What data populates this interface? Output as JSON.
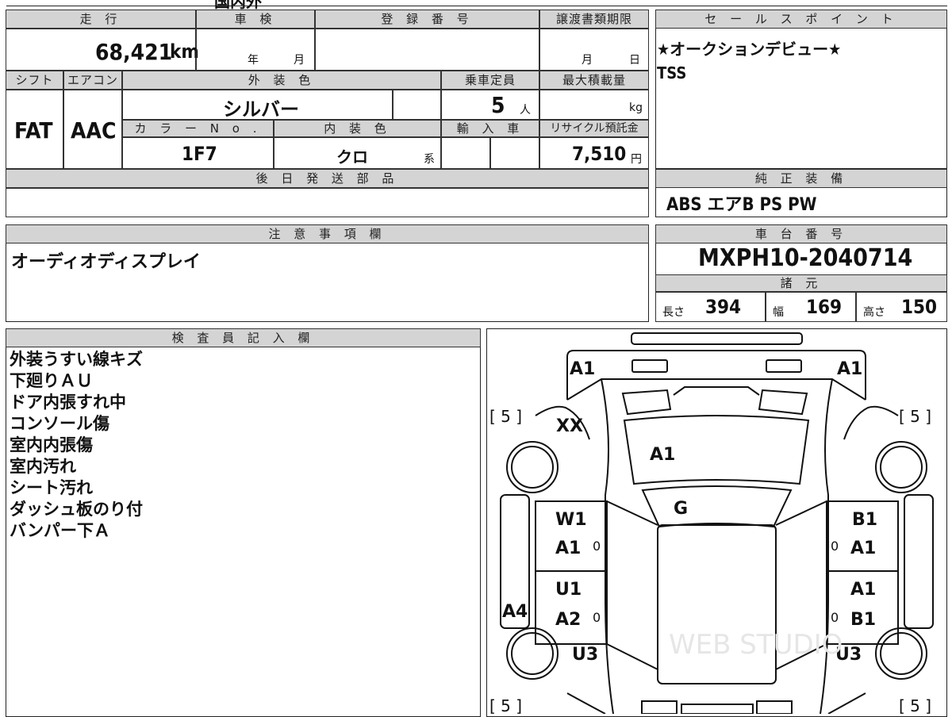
{
  "top_fragment": "国内外",
  "odometer": {
    "header": "走 行",
    "value": "68,421",
    "unit": "km"
  },
  "inspection": {
    "header": "車 検",
    "year_label": "年",
    "month_label": "月"
  },
  "registration": {
    "header": "登 録 番 号",
    "value": ""
  },
  "transfer_deadline": {
    "header": "譲渡書類期限",
    "month_label": "月",
    "day_label": "日"
  },
  "sales_point": {
    "header": "セ ー ル ス ポ イ ン ト",
    "lines": [
      "★オークションデビュー★",
      "TSS"
    ]
  },
  "shift": {
    "header": "シフト",
    "value": "FAT"
  },
  "aircon": {
    "header": "エアコン",
    "value": "AAC"
  },
  "exterior_color": {
    "header": "外 装 色",
    "value": "シルバー"
  },
  "capacity": {
    "header": "乗車定員",
    "value": "5",
    "unit": "人"
  },
  "max_load": {
    "header": "最大積載量",
    "unit": "kg"
  },
  "color_no": {
    "header": "カ ラ ー N o .",
    "value": "1F7"
  },
  "interior_color": {
    "header": "内 装 色",
    "value": "クロ",
    "suffix": "系"
  },
  "import": {
    "header": "輸 入 車",
    "value": ""
  },
  "recycle": {
    "header": "リサイクル預託金",
    "value": "7,510",
    "unit": "円"
  },
  "later_parts": {
    "header": "後 日 発 送 部 品",
    "value": ""
  },
  "factory_equipment": {
    "header": "純 正 装 備",
    "value": "ABS  エアB  PS  PW"
  },
  "notes": {
    "header": "注 意 事 項 欄",
    "value": "オーディオディスプレイ"
  },
  "chassis": {
    "header": "車 台 番 号",
    "value": "MXPH10-2040714"
  },
  "specs": {
    "header": "諸 元",
    "length_label": "長さ",
    "length": "394",
    "width_label": "幅",
    "width": "169",
    "height_label": "高さ",
    "height": "150"
  },
  "inspector": {
    "header": "検 査 員 記 入 欄",
    "lines": [
      "外装うすい線キズ",
      "下廻りＡＵ",
      "ドア内張すれ中",
      "コンソール傷",
      "室内内張傷",
      "室内汚れ",
      "シート汚れ",
      "ダッシュ板のり付",
      "バンパー下Ａ"
    ]
  },
  "diagram": {
    "front_left": "A1",
    "front_right": "A1",
    "hood_left": "XX",
    "hood": "A1",
    "windshield": "G",
    "left_front_door": [
      "W1",
      "A1"
    ],
    "left_rear_door": [
      "U1",
      "A2"
    ],
    "right_front_door": [
      "B1",
      "A1"
    ],
    "right_rear_door": [
      "A1",
      "B1"
    ],
    "left_rocker": "A4",
    "rear_left": "U3",
    "rear_right": "U3",
    "tire_tl": "[ 5 ]",
    "tire_tr": "[ 5 ]",
    "tire_bl": "[ 5 ]",
    "tire_br": "[ 5 ]",
    "zero": "0",
    "watermark": "WEB STUDIO"
  }
}
